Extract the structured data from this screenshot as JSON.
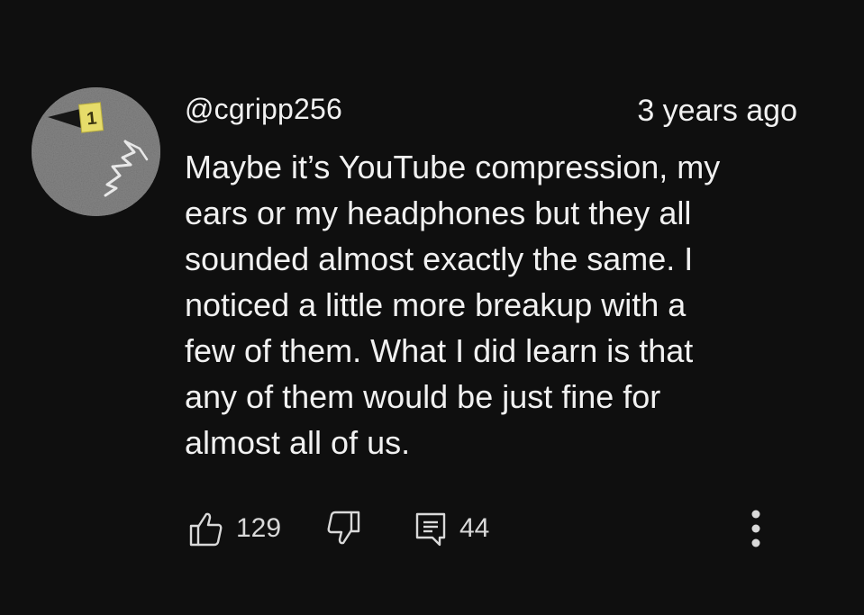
{
  "comment": {
    "author": "@cgripp256",
    "timestamp": "3 years ago",
    "text": "Maybe it’s YouTube compression, my\nears or my headphones but they all\nsounded almost exactly the same.  I\nnoticed a little more breakup with a\nfew of them.   What I did learn is that\nany of them would be just fine for\nalmost all of us.",
    "avatar_badge": "1"
  },
  "actions": {
    "likes": "129",
    "replies": "44",
    "like_icon": "thumbs-up-icon",
    "dislike_icon": "thumbs-down-icon",
    "reply_icon": "comment-icon",
    "more_icon": "vertical-ellipsis-icon"
  },
  "colors": {
    "background": "#0f0f0f",
    "text": "#f1f1f1",
    "secondary": "#d9d9d9"
  }
}
